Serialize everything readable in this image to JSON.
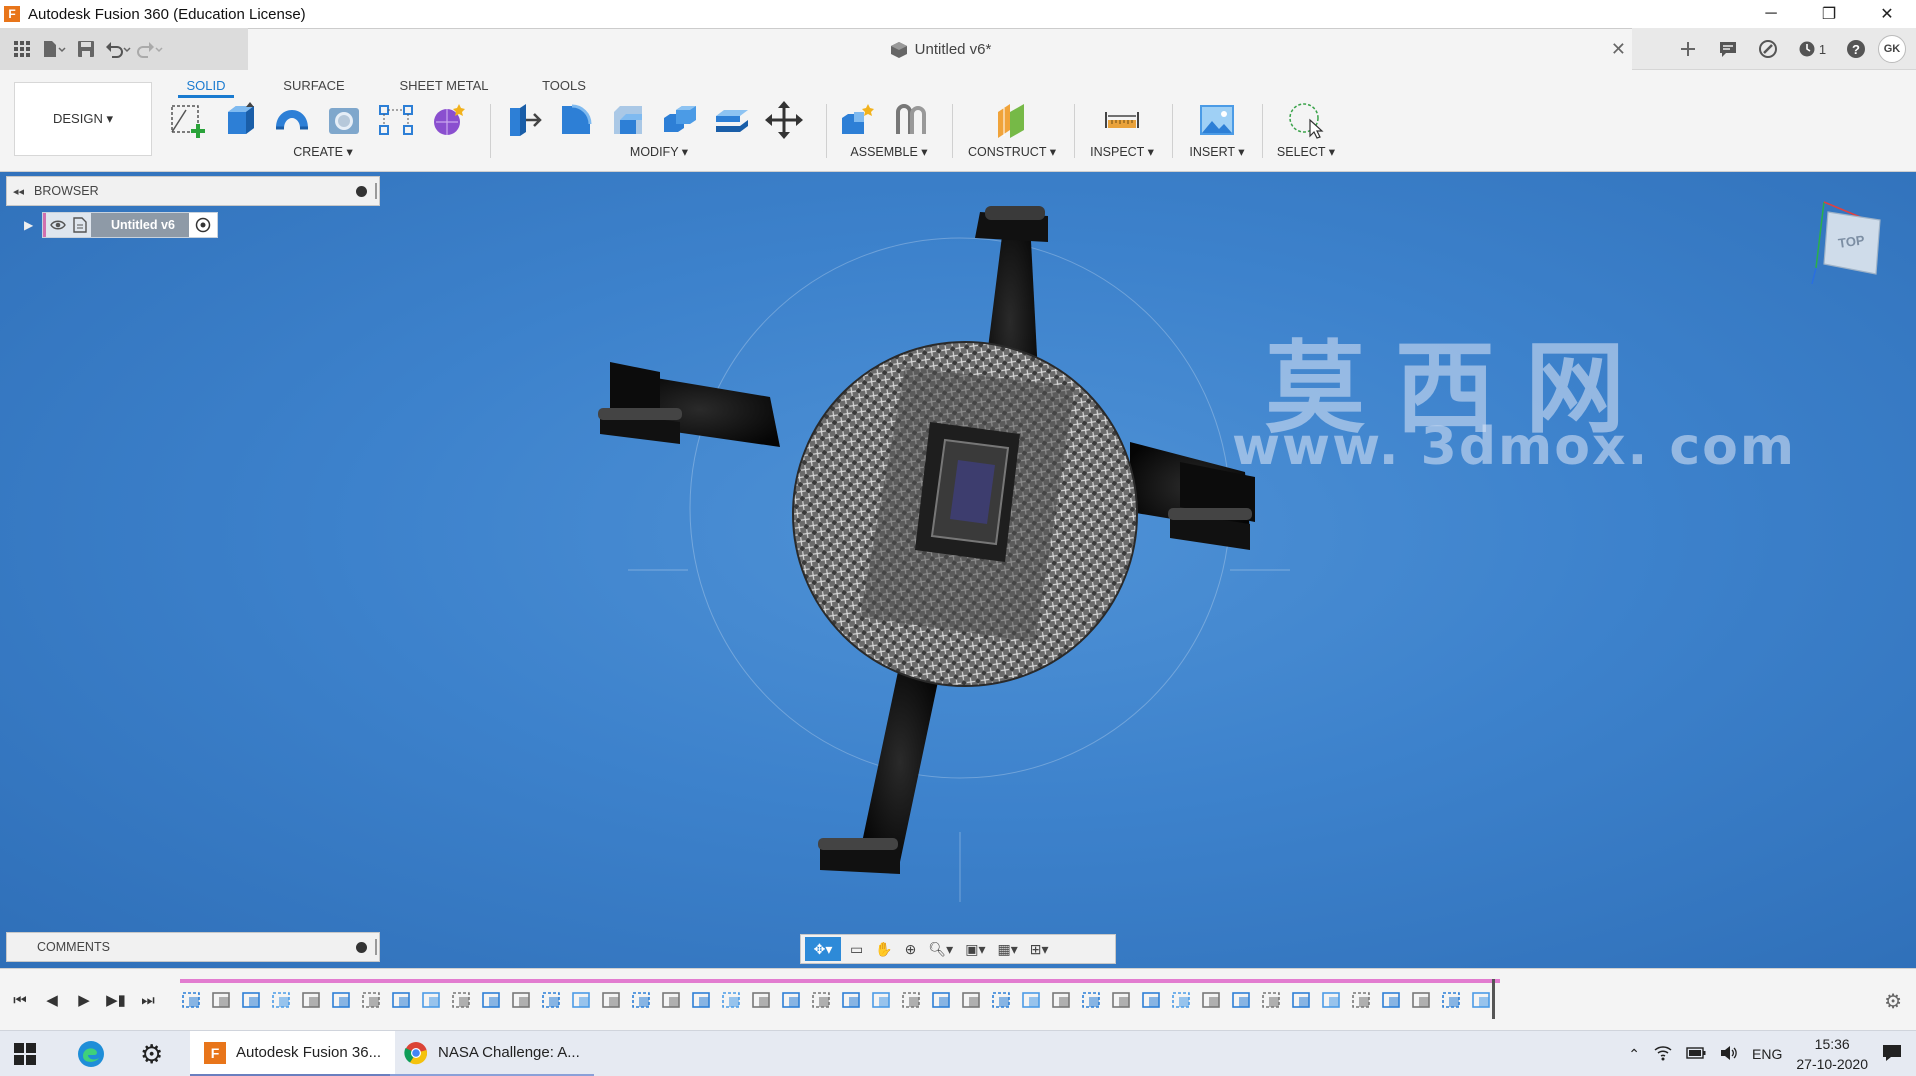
{
  "window": {
    "title": "Autodesk Fusion 360 (Education License)",
    "app_logo_letter": "F",
    "minimize": "─",
    "restore": "❐",
    "close": "✕"
  },
  "document": {
    "name": "Untitled v6*",
    "close": "✕"
  },
  "user": {
    "initials": "GK",
    "jobs_count": "1"
  },
  "workspace": {
    "label": "DESIGN ▾"
  },
  "tabs": [
    {
      "label": "SOLID",
      "active": true
    },
    {
      "label": "SURFACE",
      "active": false
    },
    {
      "label": "SHEET METAL",
      "active": false
    },
    {
      "label": "TOOLS",
      "active": false
    }
  ],
  "groups": {
    "create": "CREATE ▾",
    "modify": "MODIFY ▾",
    "assemble": "ASSEMBLE ▾",
    "construct": "CONSTRUCT ▾",
    "inspect": "INSPECT ▾",
    "insert": "INSERT ▾",
    "select": "SELECT ▾"
  },
  "browser": {
    "title": "BROWSER",
    "collapse": "◂◂",
    "root_node": "Untitled v6"
  },
  "comments": {
    "title": "COMMENTS"
  },
  "viewcube": {
    "face": "TOP"
  },
  "watermark": {
    "chinese": "莫西网",
    "url": "www. 3dmox. com"
  },
  "taskbar": {
    "apps": [
      {
        "label": "Autodesk Fusion 36..."
      },
      {
        "label": "NASA Challenge: A..."
      }
    ],
    "language": "ENG",
    "time": "15:36",
    "date": "27-10-2020"
  },
  "colors": {
    "accent": "#1a7bd0",
    "viewport_bg": "#3d82cc",
    "timeline_track": "#e27cd0"
  }
}
